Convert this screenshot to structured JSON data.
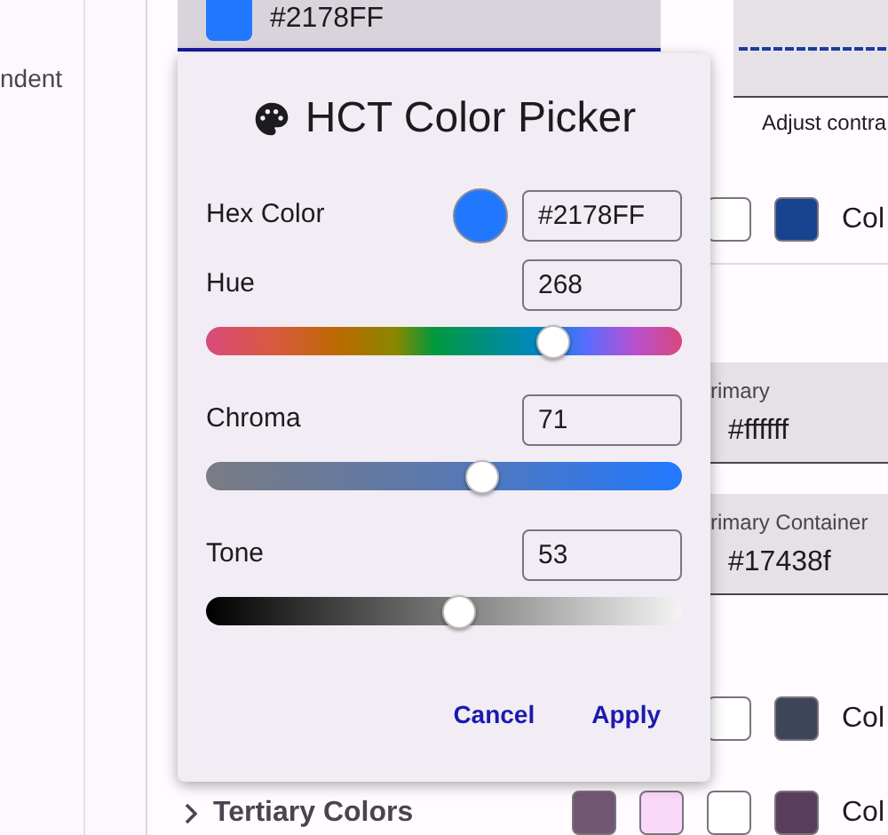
{
  "sidebar": {
    "items": [
      {
        "label": "ndent"
      }
    ]
  },
  "source_field": {
    "value": "#2178FF",
    "color": "#2178ff"
  },
  "contrast_caption": "Adjust contra",
  "rows_top": [
    {
      "swatches": [
        {
          "color": "#ffffff"
        },
        {
          "color": "#17438f"
        }
      ],
      "label": "Col"
    }
  ],
  "cards": [
    {
      "label": "rimary",
      "value": "#ffffff"
    },
    {
      "label": "rimary Container",
      "value": "#17438f"
    }
  ],
  "rows_bottom": [
    {
      "swatches": [
        {
          "color": "#ffffff"
        },
        {
          "color": "#3f4559"
        }
      ],
      "label": "Col"
    }
  ],
  "tertiary": {
    "title": "Tertiary Colors",
    "expanded": false,
    "swatches": [
      {
        "color": "#735674"
      },
      {
        "color": "#fad8fa"
      },
      {
        "color": "#ffffff"
      },
      {
        "color": "#5a3d5c"
      }
    ],
    "label": "Col"
  },
  "dialog": {
    "title": "HCT Color Picker",
    "hex_label": "Hex Color",
    "hex_value": "#2178FF",
    "sliders": [
      {
        "kind": "hue",
        "label": "Hue",
        "value": "268",
        "level": 0.73
      },
      {
        "kind": "chroma",
        "label": "Chroma",
        "value": "71",
        "level": 0.58
      },
      {
        "kind": "tone",
        "label": "Tone",
        "value": "53",
        "level": 0.53
      }
    ],
    "buttons": [
      "Cancel",
      "Apply"
    ]
  }
}
